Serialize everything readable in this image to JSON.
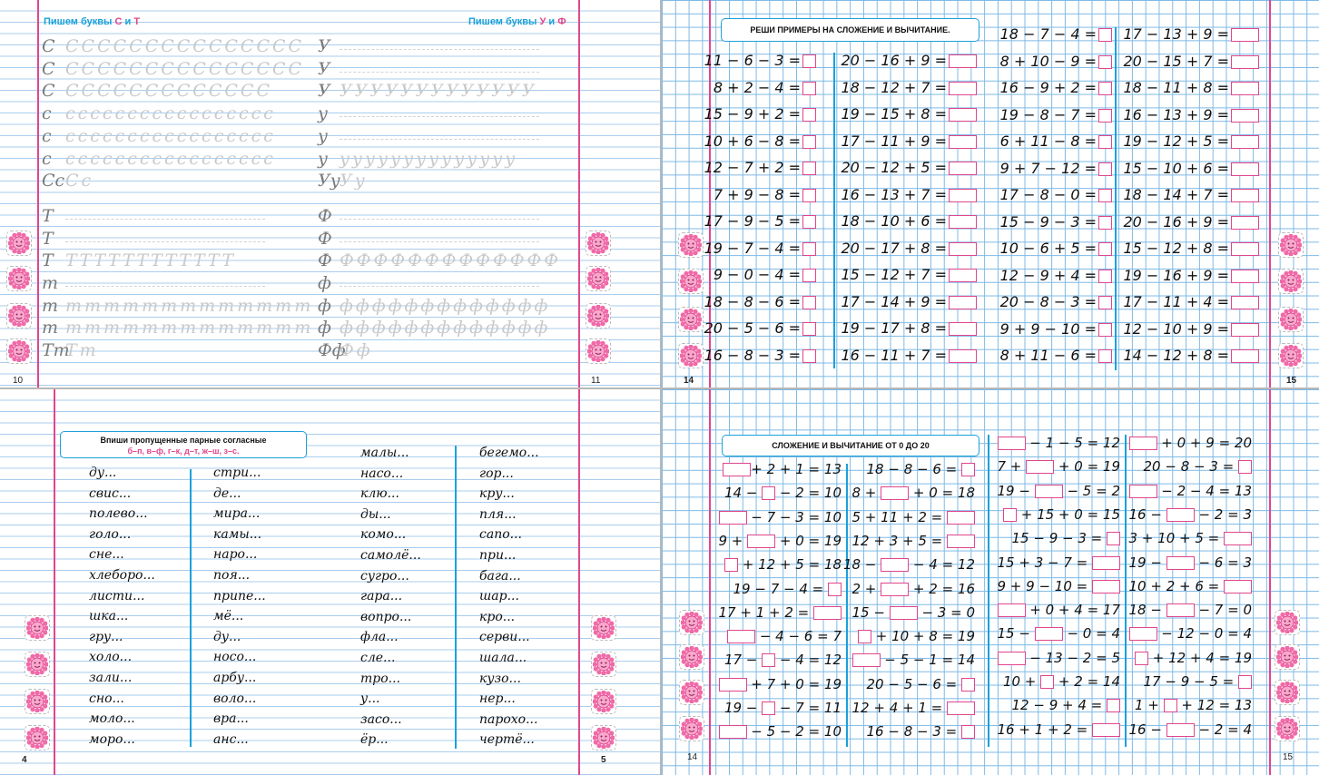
{
  "q1": {
    "title_left": {
      "text": "Пишем буквы ",
      "l1": "С",
      "and": " и ",
      "l2": "Т"
    },
    "title_right": {
      "text": "Пишем буквы ",
      "l1": "У",
      "and": " и ",
      "l2": "Ф"
    },
    "rows_left": [
      {
        "lead": "С",
        "repeat": "ССССССССССССССС"
      },
      {
        "lead": "С",
        "repeat": "ССССССССССССССС"
      },
      {
        "lead": "С",
        "repeat": "ССССССССССССС"
      },
      {
        "lead": "с",
        "repeat": "ссссссссссссссссс"
      },
      {
        "lead": "с",
        "repeat": "ссссссссссссссссс"
      },
      {
        "lead": "с",
        "repeat": "ссссссссссссссссс"
      },
      {
        "lead": "Сс",
        "repeat": "Сс"
      },
      {
        "lead": "Т",
        "repeat": ""
      },
      {
        "lead": "Т",
        "repeat": ""
      },
      {
        "lead": "Т",
        "repeat": "ТТТТТТТТТТТТ"
      },
      {
        "lead": "т",
        "repeat": ""
      },
      {
        "lead": "т",
        "repeat": "ттттттттттттт"
      },
      {
        "lead": "т",
        "repeat": "ттттттттттттт"
      },
      {
        "lead": "Тт",
        "repeat": "Тт"
      }
    ],
    "rows_right": [
      {
        "lead": "У",
        "repeat": ""
      },
      {
        "lead": "У",
        "repeat": ""
      },
      {
        "lead": "У",
        "repeat": "УУУУУУУУУУУУУ"
      },
      {
        "lead": "у",
        "repeat": ""
      },
      {
        "lead": "у",
        "repeat": ""
      },
      {
        "lead": "у",
        "repeat": "уууууууууууууу"
      },
      {
        "lead": "Уу",
        "repeat": "Уу"
      },
      {
        "lead": "Ф",
        "repeat": ""
      },
      {
        "lead": "Ф",
        "repeat": ""
      },
      {
        "lead": "Ф",
        "repeat": "ФФФФФФФФФФФФФ"
      },
      {
        "lead": "ф",
        "repeat": ""
      },
      {
        "lead": "ф",
        "repeat": "ффффффффффффф"
      },
      {
        "lead": "ф",
        "repeat": "ффффффффффффф"
      },
      {
        "lead": "Фф",
        "repeat": "Фф"
      }
    ],
    "page_left": "10",
    "page_right": "11"
  },
  "q2": {
    "title": "РЕШИ ПРИМЕРЫ НА СЛОЖЕНИЕ И ВЫЧИТАНИЕ.",
    "col1": [
      "11 − 6 − 3 =",
      "8 + 2 − 4 =",
      "15 − 9 + 2 =",
      "10 + 6 − 8 =",
      "12 − 7 + 2 =",
      "7 + 9 − 8 =",
      "17 − 9 − 5 =",
      "19 − 7 − 4 =",
      "9 − 0 − 4 =",
      "18 − 8 − 6 =",
      "20 − 5 − 6 =",
      "16 − 8 − 3 ="
    ],
    "col2": [
      "20 − 16 + 9 =",
      "18 − 12 + 7 =",
      "19 − 15 + 8 =",
      "17 − 11 + 9 =",
      "20 − 12 + 5 =",
      "16 − 13 + 7 =",
      "18 − 10 + 6 =",
      "20 − 17 + 8 =",
      "15 − 12 + 7 =",
      "17 − 14 + 9 =",
      "19 − 17 + 8 =",
      "16 − 11 + 7 ="
    ],
    "col3": [
      "18 − 7 − 4 =",
      "8 + 10 − 9 =",
      "16 − 9 + 2 =",
      "19 − 8 − 7 =",
      "6 + 11 − 8 =",
      "9 + 7 − 12 =",
      "17 − 8 − 0 =",
      "15 − 9 − 3 =",
      "10 − 6 + 5 =",
      "12 − 9 + 4 =",
      "20 − 8 − 3 =",
      "9 + 9 − 10 =",
      "8 + 11 − 6 ="
    ],
    "col4": [
      "17 − 13 + 9 =",
      "20 − 15 + 7 =",
      "18 − 11 + 8 =",
      "16 − 13 + 9 =",
      "19 − 12 + 5 =",
      "15 − 10 + 6 =",
      "18 − 14 + 7 =",
      "20 − 16 + 9 =",
      "15 − 12 + 8 =",
      "19 − 16 + 9 =",
      "17 − 11 + 4 =",
      "12 − 10 + 9 =",
      "14 − 12 + 8 ="
    ],
    "page_left": "14",
    "page_right": "15"
  },
  "q3": {
    "title": "Впиши пропущенные парные согласные",
    "subtitle": "б–п, в–ф, г–к, д–т, ж–ш, з–с.",
    "col1": [
      "ду...",
      "свис...",
      "полево...",
      "голо...",
      "сне...",
      "хлеборо...",
      "листи...",
      "шка...",
      "гру...",
      "холо...",
      "зали...",
      "сно...",
      "моло...",
      "моро..."
    ],
    "col2": [
      "стри...",
      "де...",
      "мира...",
      "камы...",
      "наро...",
      "поя...",
      "припе...",
      "мё...",
      "ду...",
      "носо...",
      "арбу...",
      "воло...",
      "вра...",
      "анс..."
    ],
    "col3": [
      "малы...",
      "насо...",
      "клю...",
      "ды...",
      "комо...",
      "самолё...",
      "сугро...",
      "гара...",
      "вопро...",
      "фла...",
      "сле...",
      "тро...",
      "у...",
      "засо...",
      "ёр..."
    ],
    "col4": [
      "бегемо...",
      "гор...",
      "кру...",
      "пля...",
      "сапо...",
      "при...",
      "бага...",
      "шар...",
      "кро...",
      "серви...",
      "шала...",
      "кузо...",
      "нер...",
      "парохо...",
      "чертё..."
    ],
    "page_left": "4",
    "page_right": "5"
  },
  "q4": {
    "title": "СЛОЖЕНИЕ И ВЫЧИТАНИЕ ОТ 0 ДО 20",
    "col1": [
      [
        {
          "b": "r"
        },
        {
          "t": "+ 2 + 1 = 13"
        }
      ],
      [
        {
          "t": "14 − "
        },
        {
          "b": "s"
        },
        {
          "t": " − 2 = 10"
        }
      ],
      [
        {
          "b": "r"
        },
        {
          "t": " − 7 − 3 = 10"
        }
      ],
      [
        {
          "t": "9 + "
        },
        {
          "b": "r"
        },
        {
          "t": " + 0 = 19"
        }
      ],
      [
        {
          "b": "s"
        },
        {
          "t": " + 12 + 5 = 18"
        }
      ],
      [
        {
          "t": "19 − 7 − 4 = "
        },
        {
          "b": "s"
        }
      ],
      [
        {
          "t": "17 + 1 + 2 = "
        },
        {
          "b": "r"
        }
      ],
      [
        {
          "b": "r"
        },
        {
          "t": " − 4 − 6 = 7"
        }
      ],
      [
        {
          "t": "17 − "
        },
        {
          "b": "s"
        },
        {
          "t": " − 4 = 12"
        }
      ],
      [
        {
          "b": "r"
        },
        {
          "t": " + 7 + 0 = 19"
        }
      ],
      [
        {
          "t": "19 − "
        },
        {
          "b": "s"
        },
        {
          "t": " − 7 = 11"
        }
      ],
      [
        {
          "b": "r"
        },
        {
          "t": " − 5 − 2 = 10"
        }
      ]
    ],
    "col2": [
      [
        {
          "t": "18 − 8 − 6 = "
        },
        {
          "b": "s"
        }
      ],
      [
        {
          "t": "8 + "
        },
        {
          "b": "r"
        },
        {
          "t": " + 0 = 18"
        }
      ],
      [
        {
          "t": "5 + 11 + 2 = "
        },
        {
          "b": "r"
        }
      ],
      [
        {
          "t": "12 + 3 + 5 = "
        },
        {
          "b": "r"
        }
      ],
      [
        {
          "t": "18 − "
        },
        {
          "b": "r"
        },
        {
          "t": " − 4 = 12"
        }
      ],
      [
        {
          "t": "2 + "
        },
        {
          "b": "r"
        },
        {
          "t": " + 2 = 16"
        }
      ],
      [
        {
          "t": "15 − "
        },
        {
          "b": "r"
        },
        {
          "t": " − 3 = 0"
        }
      ],
      [
        {
          "b": "s"
        },
        {
          "t": " + 10 + 8 = 19"
        }
      ],
      [
        {
          "b": "r"
        },
        {
          "t": " − 5 − 1 = 14"
        }
      ],
      [
        {
          "t": "20 − 5 − 6 = "
        },
        {
          "b": "s"
        }
      ],
      [
        {
          "t": "12 + 4 + 1 = "
        },
        {
          "b": "r"
        }
      ],
      [
        {
          "t": "16 − 8 − 3 = "
        },
        {
          "b": "s"
        }
      ]
    ],
    "col3": [
      [
        {
          "b": "r"
        },
        {
          "t": " − 1 − 5 = 12"
        }
      ],
      [
        {
          "t": "7 + "
        },
        {
          "b": "r"
        },
        {
          "t": " + 0 = 19"
        }
      ],
      [
        {
          "t": "19 − "
        },
        {
          "b": "r"
        },
        {
          "t": " − 5 = 2"
        }
      ],
      [
        {
          "b": "s"
        },
        {
          "t": " + 15 + 0 = 15"
        }
      ],
      [
        {
          "t": "15 − 9 − 3 = "
        },
        {
          "b": "s"
        }
      ],
      [
        {
          "t": "15 + 3 − 7 = "
        },
        {
          "b": "r"
        }
      ],
      [
        {
          "t": "9 + 9 − 10 = "
        },
        {
          "b": "r"
        }
      ],
      [
        {
          "b": "r"
        },
        {
          "t": " + 0 + 4 = 17"
        }
      ],
      [
        {
          "t": "15 − "
        },
        {
          "b": "r"
        },
        {
          "t": " − 0 = 4"
        }
      ],
      [
        {
          "b": "r"
        },
        {
          "t": " − 13 − 2 = 5"
        }
      ],
      [
        {
          "t": "10 + "
        },
        {
          "b": "s"
        },
        {
          "t": " + 2 = 14"
        }
      ],
      [
        {
          "t": "12 − 9 + 4 = "
        },
        {
          "b": "s"
        }
      ],
      [
        {
          "t": "16 + 1 + 2 = "
        },
        {
          "b": "r"
        }
      ]
    ],
    "col4": [
      [
        {
          "b": "r"
        },
        {
          "t": " + 0 + 9 = 20"
        }
      ],
      [
        {
          "t": "20 − 8 − 3 = "
        },
        {
          "b": "s"
        }
      ],
      [
        {
          "b": "r"
        },
        {
          "t": " − 2 − 4 = 13"
        }
      ],
      [
        {
          "t": "16 − "
        },
        {
          "b": "r"
        },
        {
          "t": " − 2 = 3"
        }
      ],
      [
        {
          "t": "3 + 10 + 5 = "
        },
        {
          "b": "r"
        }
      ],
      [
        {
          "t": "19 − "
        },
        {
          "b": "r"
        },
        {
          "t": " − 6 = 3"
        }
      ],
      [
        {
          "t": "10 + 2 + 6 = "
        },
        {
          "b": "r"
        }
      ],
      [
        {
          "t": "18 − "
        },
        {
          "b": "r"
        },
        {
          "t": " − 7 = 0"
        }
      ],
      [
        {
          "b": "r"
        },
        {
          "t": " − 12 − 0 = 4"
        }
      ],
      [
        {
          "b": "s"
        },
        {
          "t": " + 12 + 4 = 19"
        }
      ],
      [
        {
          "t": "17 − 9 − 5 = "
        },
        {
          "b": "s"
        }
      ],
      [
        {
          "t": "1 + "
        },
        {
          "b": "s"
        },
        {
          "t": " + 12 = 13"
        }
      ],
      [
        {
          "t": "16 − "
        },
        {
          "b": "r"
        },
        {
          "t": " − 2 = 4"
        }
      ]
    ],
    "page_left": "14",
    "page_right": "15"
  },
  "colors": {
    "accent_pink": "#e0468c",
    "accent_blue": "#1ba1d9",
    "grid_blue": "#7db9e6"
  },
  "icons": {
    "sun": "sun-face-icon"
  }
}
